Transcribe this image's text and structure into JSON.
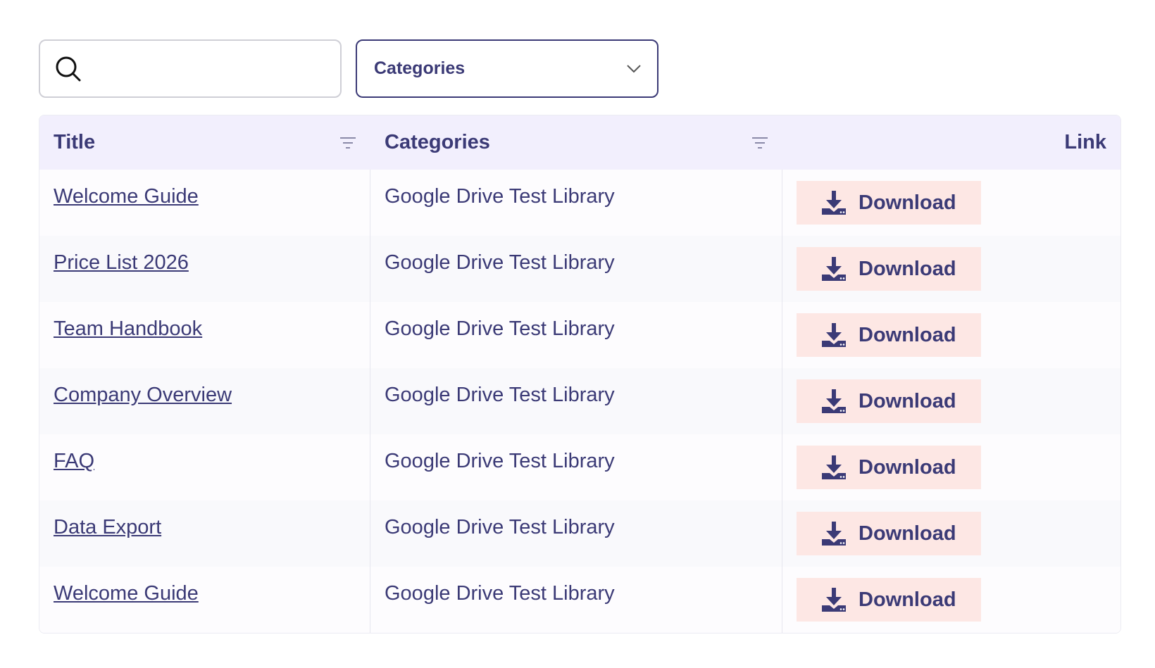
{
  "search": {
    "placeholder": "",
    "value": ""
  },
  "category_filter": {
    "selected": "Categories"
  },
  "table": {
    "headers": {
      "title": "Title",
      "categories": "Categories",
      "link": "Link"
    },
    "rows": [
      {
        "title": "Welcome Guide",
        "category": "Google Drive Test Library",
        "link_label": "Download"
      },
      {
        "title": "Price List 2026",
        "category": "Google Drive Test Library",
        "link_label": "Download"
      },
      {
        "title": "Team Handbook",
        "category": "Google Drive Test Library",
        "link_label": "Download"
      },
      {
        "title": "Company Overview",
        "category": "Google Drive Test Library",
        "link_label": "Download"
      },
      {
        "title": "FAQ",
        "category": "Google Drive Test Library",
        "link_label": "Download"
      },
      {
        "title": "Data Export",
        "category": "Google Drive Test Library",
        "link_label": "Download"
      },
      {
        "title": "Welcome Guide",
        "category": "Google Drive Test Library",
        "link_label": "Download"
      }
    ]
  },
  "icons": {
    "search": "search-icon",
    "dropdown": "chevron-down-icon",
    "filter": "filter-icon",
    "download": "download-icon"
  },
  "colors": {
    "primary": "#3b3a76",
    "header_bg": "#f2effd",
    "button_bg": "#fde7e4"
  }
}
